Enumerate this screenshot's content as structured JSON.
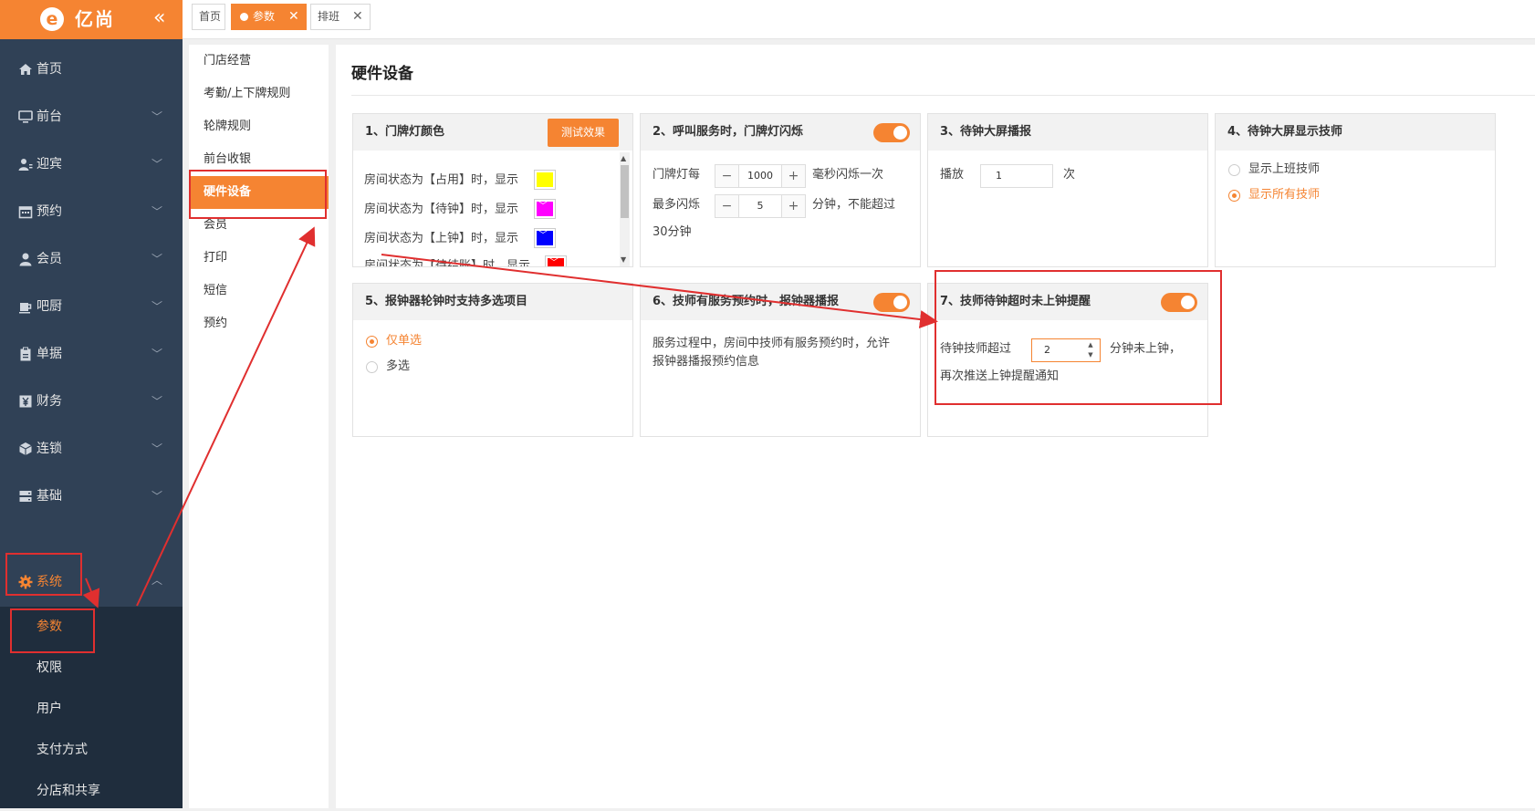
{
  "brand": {
    "logo_letter": "e",
    "name": "亿尚",
    "collapse_glyph": "«"
  },
  "sidebar": {
    "items": [
      {
        "label": "首页",
        "icon": "home-icon",
        "has_chevron": false
      },
      {
        "label": "前台",
        "icon": "monitor-icon",
        "has_chevron": true
      },
      {
        "label": "迎宾",
        "icon": "users-icon",
        "has_chevron": true
      },
      {
        "label": "预约",
        "icon": "calendar-icon",
        "has_chevron": true
      },
      {
        "label": "会员",
        "icon": "user-icon",
        "has_chevron": true
      },
      {
        "label": "吧厨",
        "icon": "cup-icon",
        "has_chevron": true
      },
      {
        "label": "单据",
        "icon": "clipboard-icon",
        "has_chevron": true
      },
      {
        "label": "财务",
        "icon": "yen-icon",
        "has_chevron": true
      },
      {
        "label": "连锁",
        "icon": "cube-icon",
        "has_chevron": true
      },
      {
        "label": "基础",
        "icon": "server-icon",
        "has_chevron": true
      },
      {
        "label": "系统",
        "icon": "gear-icon",
        "has_chevron": true,
        "expanded": true,
        "active": true
      }
    ],
    "system_submenu": [
      "参数",
      "权限",
      "用户",
      "支付方式",
      "分店和共享"
    ],
    "active_submenu": "参数"
  },
  "tabs": [
    {
      "label": "首页",
      "closable": false,
      "active": false
    },
    {
      "label": "参数",
      "closable": true,
      "active": true
    },
    {
      "label": "排班",
      "closable": true,
      "active": false
    }
  ],
  "tab_close_glyph": "✕",
  "settings_menu": {
    "items": [
      "门店经营",
      "考勤/上下牌规则",
      "轮牌规则",
      "前台收银",
      "硬件设备",
      "会员",
      "打印",
      "短信",
      "预约"
    ],
    "active": "硬件设备"
  },
  "page": {
    "title": "硬件设备"
  },
  "cards": {
    "c1": {
      "title": "1、门牌灯颜色",
      "test_button": "测试效果",
      "rows": [
        {
          "label": "房间状态为【占用】时，显示",
          "color": "#ffff00"
        },
        {
          "label": "房间状态为【待钟】时，显示",
          "color": "#ff00ff"
        },
        {
          "label": "房间状态为【上钟】时，显示",
          "color": "#0000ff"
        },
        {
          "label": "房间状态为【待结账】时，显示",
          "color": "#ff0000"
        }
      ]
    },
    "c2": {
      "title": "2、呼叫服务时，门牌灯闪烁",
      "enabled": true,
      "row1_prefix": "门牌灯每",
      "row1_value": "1000",
      "row1_suffix": "毫秒闪烁一次",
      "row2_prefix": "最多闪烁",
      "row2_value": "5",
      "row2_suffix": "分钟，不能超过",
      "row3": "30分钟"
    },
    "c3": {
      "title": "3、待钟大屏播报",
      "prefix": "播放",
      "value": "1",
      "suffix": "次"
    },
    "c4": {
      "title": "4、待钟大屏显示技师",
      "options": [
        "显示上班技师",
        "显示所有技师"
      ],
      "selected": "显示所有技师"
    },
    "c5": {
      "title": "5、报钟器轮钟时支持多选项目",
      "options": [
        "仅单选",
        "多选"
      ],
      "selected": "仅单选"
    },
    "c6": {
      "title": "6、技师有服务预约时，报钟器播报",
      "enabled": true,
      "desc1": "服务过程中，房间中技师有服务预约时，允许",
      "desc2": "报钟器播报预约信息"
    },
    "c7": {
      "title": "7、技师待钟超时未上钟提醒",
      "enabled": true,
      "prefix": "待钟技师超过",
      "value": "2",
      "suffix": "分钟未上钟，",
      "line2": "再次推送上钟提醒通知"
    }
  },
  "colors": {
    "accent": "#f58432",
    "sidebar_bg": "#304156",
    "submenu_bg": "#1f2d3d",
    "annotation": "#e02f2f"
  }
}
